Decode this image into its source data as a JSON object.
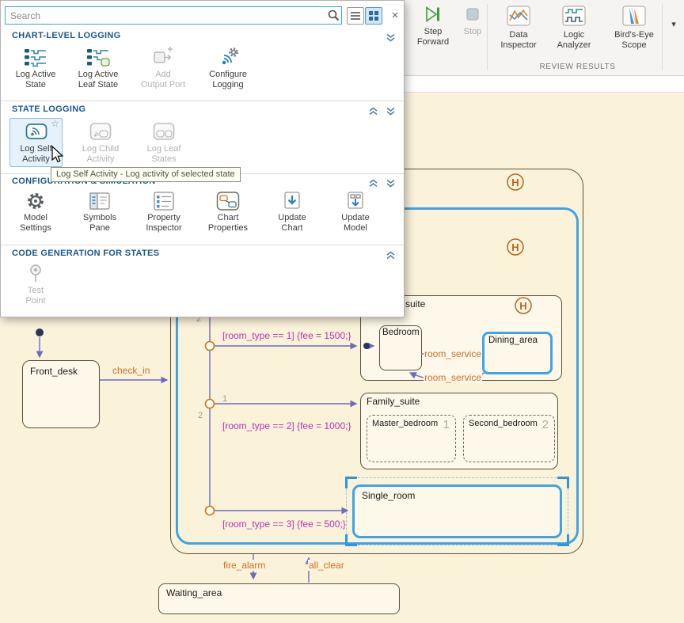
{
  "search": {
    "placeholder": "Search"
  },
  "icons": {
    "close": "×",
    "star": "☆",
    "dropdown": "▾"
  },
  "popup": {
    "tooltip": "Log Self Activity - Log activity of selected state",
    "sections": [
      {
        "title": "CHART-LEVEL LOGGING",
        "buttons": [
          {
            "line1": "Log Active",
            "line2": "State"
          },
          {
            "line1": "Log Active",
            "line2": "Leaf State"
          },
          {
            "line1": "Add",
            "line2": "Output Port"
          },
          {
            "line1": "Configure",
            "line2": "Logging"
          }
        ]
      },
      {
        "title": "STATE LOGGING",
        "buttons": [
          {
            "line1": "Log Self",
            "line2": "Activity"
          },
          {
            "line1": "Log Child",
            "line2": "Activity"
          },
          {
            "line1": "Log Leaf",
            "line2": "States"
          }
        ]
      },
      {
        "title": "CONFIGURATION & SIMULATION",
        "buttons": [
          {
            "line1": "Model",
            "line2": "Settings"
          },
          {
            "line1": "Symbols",
            "line2": "Pane"
          },
          {
            "line1": "Property",
            "line2": "Inspector"
          },
          {
            "line1": "Chart",
            "line2": "Properties"
          },
          {
            "line1": "Update",
            "line2": "Chart"
          },
          {
            "line1": "Update",
            "line2": "Model"
          }
        ]
      },
      {
        "title": "CODE GENERATION FOR STATES",
        "buttons": [
          {
            "line1": "Test",
            "line2": "Point"
          }
        ]
      }
    ]
  },
  "toolbar": {
    "step_forward": {
      "line1": "Step",
      "line2": "Forward"
    },
    "stop_label": "Stop",
    "review": {
      "label": "REVIEW RESULTS",
      "items": [
        {
          "line1": "Data",
          "line2": "Inspector"
        },
        {
          "line1": "Logic",
          "line2": "Analyzer"
        },
        {
          "line1": "Bird's-Eye",
          "line2": "Scope"
        }
      ]
    }
  },
  "chart": {
    "history_label": "H",
    "states": {
      "suite": "suite",
      "bedroom": "Bedroom",
      "dining": "Dining_area",
      "family": "Family_suite",
      "master": "Master_bedroom",
      "master_order": "1",
      "second": "Second_bedroom",
      "second_order": "2",
      "single": "Single_room",
      "front_desk": "Front_desk",
      "waiting": "Waiting_area"
    },
    "transitions": {
      "check_in": "check_in",
      "room_service_top": "room_service",
      "room_service_bottom": "room_service",
      "fire_alarm": "fire_alarm",
      "all_clear": "all_clear"
    },
    "conditions": {
      "c1": "[room_type == 1] {fee = 1500;}",
      "c2": "[room_type == 2] {fee = 1000;}",
      "c3": "[room_type == 3] {fee = 500;}"
    },
    "orders": {
      "o1": "2",
      "o2": "1",
      "o3": "2"
    }
  },
  "colors": {
    "selection_blue": "#3fa3e8",
    "transition_purple": "#6b6bbf",
    "condition_magenta": "#b334b3",
    "event_orange": "#d07020",
    "junction_orange": "#c4781a",
    "canvas_cream": "#fbf2da"
  }
}
